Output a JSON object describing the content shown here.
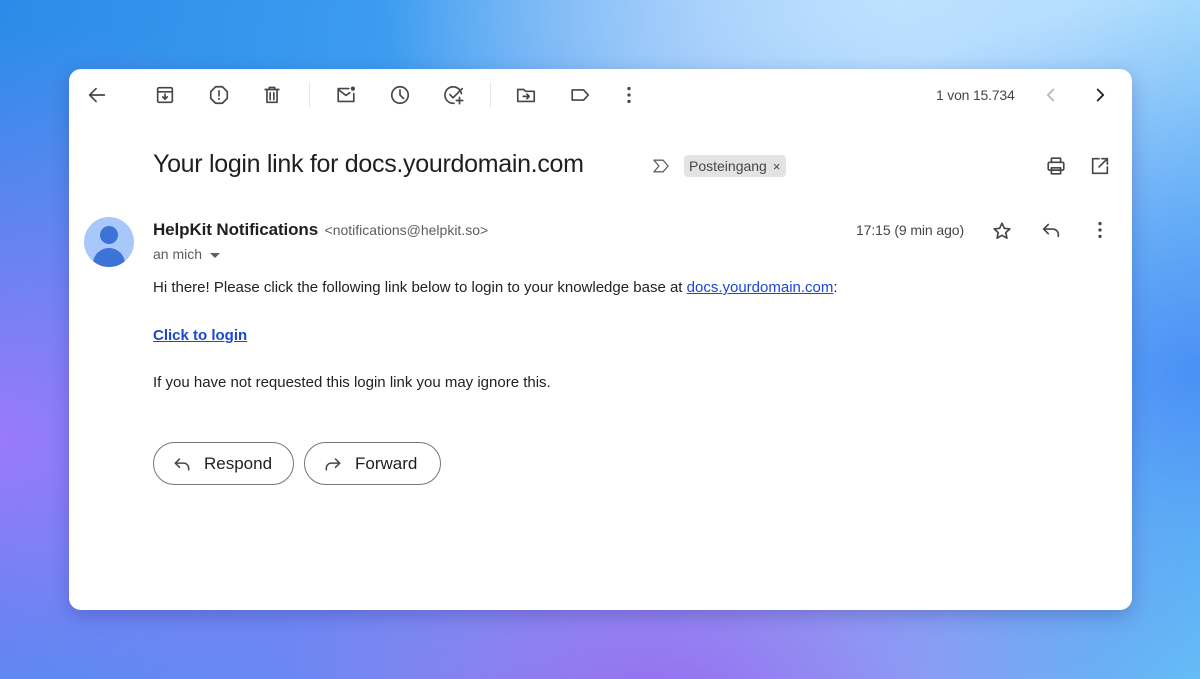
{
  "toolbar": {
    "icons": {
      "back": "arrow-left-icon",
      "archive": "archive-icon",
      "spam": "report-spam-icon",
      "delete": "trash-icon",
      "mark_unread": "mark-unread-icon",
      "snooze": "clock-icon",
      "add_task": "add-task-icon",
      "move_to": "move-to-folder-icon",
      "labels": "label-icon",
      "more": "more-vert-icon"
    },
    "pager": {
      "text": "1 von 15.734",
      "prev_icon": "chevron-left-icon",
      "next_icon": "chevron-right-icon",
      "prev_disabled": true
    }
  },
  "message": {
    "subject": "Your login link for docs.yourdomain.com",
    "importance_icon": "importance-marker-icon",
    "label_chip": {
      "label": "Posteingang",
      "remove_glyph": "×"
    },
    "header_actions": {
      "print_icon": "print-icon",
      "open_new_window_icon": "open-in-new-icon"
    },
    "sender": {
      "name": "HelpKit Notifications",
      "email": "<notifications@helpkit.so>",
      "recipient": "an mich",
      "avatar_icon": "person-icon"
    },
    "timestamp": "17:15 (9 min ago)",
    "actions": {
      "star_icon": "star-icon",
      "reply_icon": "reply-icon",
      "more_icon": "more-vert-icon"
    },
    "body": {
      "intro": "Hi there! Please click the following link below to login to your knowledge base at ",
      "intro_link": "docs.yourdomain.com",
      "intro_suffix": ":",
      "login_link": "Click to login",
      "footer": "If you have not requested this login link you may ignore this."
    }
  },
  "reply_buttons": {
    "respond": "Respond",
    "forward": "Forward"
  },
  "colors": {
    "link": "#1a47d6",
    "avatar_bg": "#a8c7fa",
    "avatar_fg": "#3d73d6",
    "chip_bg": "#e3e3e3",
    "icon": "#444746"
  }
}
